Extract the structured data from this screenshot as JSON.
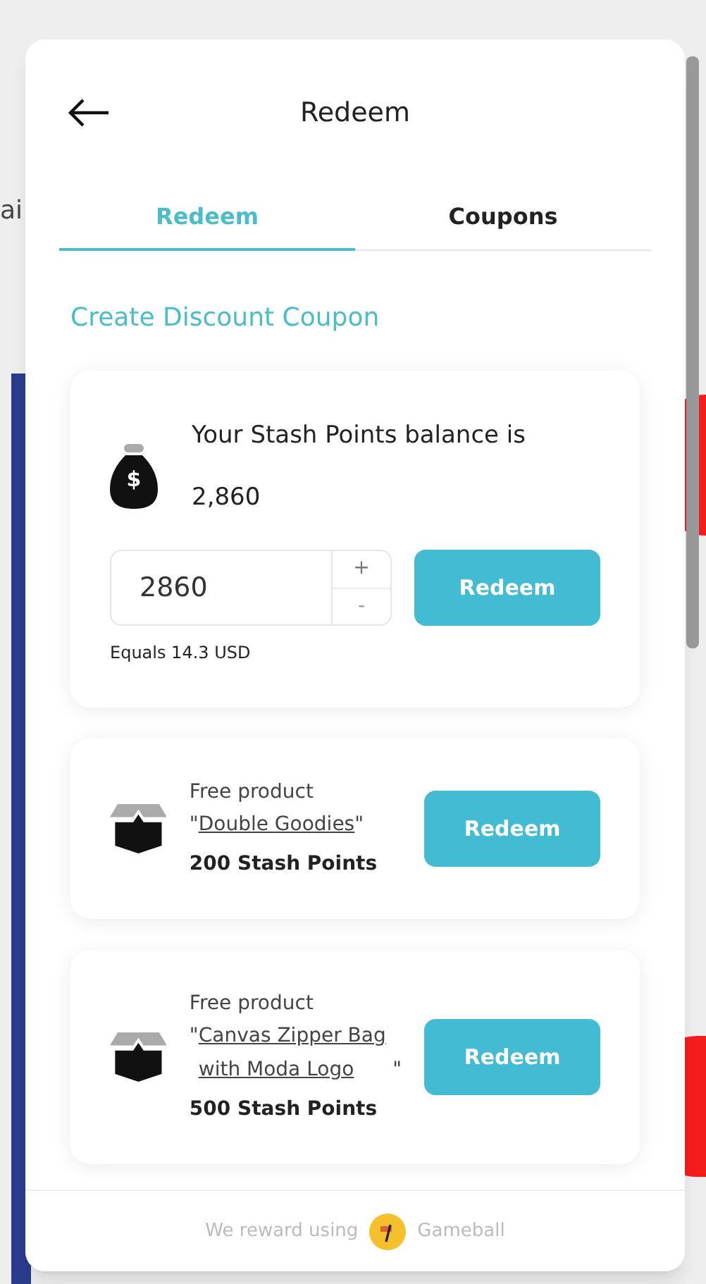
{
  "background": {
    "side_text": "ai"
  },
  "header": {
    "title": "Redeem"
  },
  "tabs": [
    {
      "label": "Redeem",
      "selected": true
    },
    {
      "label": "Coupons",
      "selected": false
    }
  ],
  "create_link": "Create Discount Coupon",
  "balance_card": {
    "icon_symbol": "$",
    "label": "Your Stash Points balance is",
    "points": "2,860",
    "amount": "2860",
    "plus": "+",
    "minus": "-",
    "button": "Redeem",
    "equals": "Equals 14.3 USD"
  },
  "rewards": [
    {
      "caption": "Free product",
      "open_quote": "\"",
      "product": "Double Goodies",
      "close_quote": "\"",
      "cost": "200 Stash Points",
      "button": "Redeem"
    },
    {
      "caption": "Free product",
      "open_quote": "\"",
      "product": "Canvas Zipper Bag with Moda Logo",
      "close_quote": "\"",
      "cost": "500 Stash Points",
      "button": "Redeem"
    }
  ],
  "footer": {
    "text": "We reward using",
    "brand": "Gameball"
  }
}
